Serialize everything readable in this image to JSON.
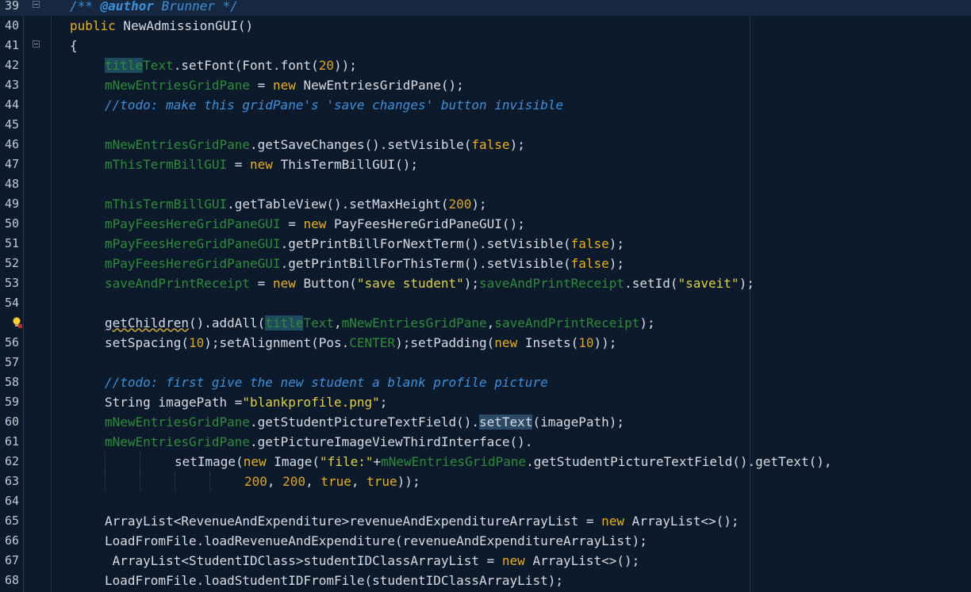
{
  "editor": {
    "theme_colors": {
      "background": "#0d1a2c",
      "keyword": "#e8b021",
      "field": "#2e8b39",
      "string": "#e0cf4a",
      "comment": "#3f8fd9",
      "text": "#d8dce2"
    },
    "lines": [
      {
        "num": "39",
        "current": true,
        "indent": 1,
        "fold": true,
        "tokens": [
          [
            "c",
            "/** "
          ],
          [
            "ca",
            "@author"
          ],
          [
            "c",
            " Brunner */"
          ]
        ]
      },
      {
        "num": "40",
        "indent": 1,
        "tokens": [
          [
            "k",
            "public"
          ],
          [
            "t",
            " NewAdmissionGUI()"
          ]
        ]
      },
      {
        "num": "41",
        "indent": 1,
        "fold": true,
        "tokens": [
          [
            "t",
            "{"
          ]
        ]
      },
      {
        "num": "42",
        "indent": 2,
        "tokens": [
          [
            "fh",
            "title"
          ],
          [
            "f",
            "Text"
          ],
          [
            "t",
            ".setFont(Font.font("
          ],
          [
            "n",
            "20"
          ],
          [
            "t",
            "));"
          ]
        ]
      },
      {
        "num": "43",
        "indent": 2,
        "tokens": [
          [
            "f",
            "mNewEntriesGridPane"
          ],
          [
            "t",
            " = "
          ],
          [
            "k",
            "new"
          ],
          [
            "t",
            " NewEntriesGridPane();"
          ]
        ]
      },
      {
        "num": "44",
        "indent": 2,
        "tokens": [
          [
            "c",
            "//todo: make this gridPane's 'save changes' button invisible"
          ]
        ]
      },
      {
        "num": "45",
        "indent": 2,
        "tokens": []
      },
      {
        "num": "46",
        "indent": 2,
        "tokens": [
          [
            "f",
            "mNewEntriesGridPane"
          ],
          [
            "t",
            ".getSaveChanges().setVisible("
          ],
          [
            "k",
            "false"
          ],
          [
            "t",
            ");"
          ]
        ]
      },
      {
        "num": "47",
        "indent": 2,
        "tokens": [
          [
            "f",
            "mThisTermBillGUI"
          ],
          [
            "t",
            " = "
          ],
          [
            "k",
            "new"
          ],
          [
            "t",
            " ThisTermBillGUI();"
          ]
        ]
      },
      {
        "num": "48",
        "indent": 2,
        "tokens": []
      },
      {
        "num": "49",
        "indent": 2,
        "tokens": [
          [
            "f",
            "mThisTermBillGUI"
          ],
          [
            "t",
            ".getTableView().setMaxHeight("
          ],
          [
            "n",
            "200"
          ],
          [
            "t",
            ");"
          ]
        ]
      },
      {
        "num": "50",
        "indent": 2,
        "tokens": [
          [
            "f",
            "mPayFeesHereGridPaneGUI"
          ],
          [
            "t",
            " = "
          ],
          [
            "k",
            "new"
          ],
          [
            "t",
            " PayFeesHereGridPaneGUI();"
          ]
        ]
      },
      {
        "num": "51",
        "indent": 2,
        "tokens": [
          [
            "f",
            "mPayFeesHereGridPaneGUI"
          ],
          [
            "t",
            ".getPrintBillForNextTerm().setVisible("
          ],
          [
            "k",
            "false"
          ],
          [
            "t",
            ");"
          ]
        ]
      },
      {
        "num": "52",
        "indent": 2,
        "tokens": [
          [
            "f",
            "mPayFeesHereGridPaneGUI"
          ],
          [
            "t",
            ".getPrintBillForThisTerm().setVisible("
          ],
          [
            "k",
            "false"
          ],
          [
            "t",
            ");"
          ]
        ]
      },
      {
        "num": "53",
        "indent": 2,
        "tokens": [
          [
            "f",
            "saveAndPrintReceipt"
          ],
          [
            "t",
            " = "
          ],
          [
            "k",
            "new"
          ],
          [
            "t",
            " Button("
          ],
          [
            "s",
            "\"save student\""
          ],
          [
            "t",
            ");"
          ],
          [
            "f",
            "saveAndPrintReceipt"
          ],
          [
            "t",
            ".setId("
          ],
          [
            "s",
            "\"saveit\""
          ],
          [
            "t",
            ");"
          ]
        ]
      },
      {
        "num": "54",
        "indent": 2,
        "tokens": []
      },
      {
        "num": "",
        "bulb": true,
        "indent": 2,
        "tokens": [
          [
            "w",
            "getChildren"
          ],
          [
            "t",
            "().addAll("
          ],
          [
            "fh",
            "title"
          ],
          [
            "f",
            "Text"
          ],
          [
            "t",
            ","
          ],
          [
            "f",
            "mNewEntriesGridPane"
          ],
          [
            "t",
            ","
          ],
          [
            "f",
            "saveAndPrintReceipt"
          ],
          [
            "t",
            ");"
          ]
        ]
      },
      {
        "num": "56",
        "indent": 2,
        "tokens": [
          [
            "t",
            "setSpacing("
          ],
          [
            "n",
            "10"
          ],
          [
            "t",
            ");setAlignment(Pos."
          ],
          [
            "f",
            "CENTER"
          ],
          [
            "t",
            ");setPadding("
          ],
          [
            "k",
            "new"
          ],
          [
            "t",
            " Insets("
          ],
          [
            "n",
            "10"
          ],
          [
            "t",
            "));"
          ]
        ]
      },
      {
        "num": "57",
        "indent": 2,
        "tokens": []
      },
      {
        "num": "58",
        "indent": 2,
        "tokens": [
          [
            "c",
            "//todo: first give the new student a blank profile picture"
          ]
        ]
      },
      {
        "num": "59",
        "indent": 2,
        "tokens": [
          [
            "t",
            "String imagePath ="
          ],
          [
            "s",
            "\"blankprofile.png\""
          ],
          [
            "t",
            ";"
          ]
        ]
      },
      {
        "num": "60",
        "indent": 2,
        "tokens": [
          [
            "f",
            "mNewEntriesGridPane"
          ],
          [
            "t",
            ".getStudentPictureTextField()."
          ],
          [
            "th",
            "setText"
          ],
          [
            "t",
            "(imagePath);"
          ]
        ]
      },
      {
        "num": "61",
        "indent": 2,
        "tokens": [
          [
            "f",
            "mNewEntriesGridPane"
          ],
          [
            "t",
            ".getPictureImageViewThirdInterface()."
          ]
        ]
      },
      {
        "num": "62",
        "indent": 4,
        "guides": [
          2,
          3
        ],
        "tokens": [
          [
            "t",
            "setImage("
          ],
          [
            "k",
            "new"
          ],
          [
            "t",
            " Image("
          ],
          [
            "s",
            "\"file:\""
          ],
          [
            "t",
            "+"
          ],
          [
            "f",
            "mNewEntriesGridPane"
          ],
          [
            "t",
            ".getStudentPictureTextField().getText(),"
          ]
        ]
      },
      {
        "num": "63",
        "indent": 6,
        "guides": [
          2,
          3,
          4,
          5
        ],
        "tokens": [
          [
            "n",
            "200"
          ],
          [
            "t",
            ", "
          ],
          [
            "n",
            "200"
          ],
          [
            "t",
            ", "
          ],
          [
            "k",
            "true"
          ],
          [
            "t",
            ", "
          ],
          [
            "k",
            "true"
          ],
          [
            "t",
            "));"
          ]
        ]
      },
      {
        "num": "64",
        "indent": 2,
        "tokens": []
      },
      {
        "num": "65",
        "indent": 2,
        "tokens": [
          [
            "t",
            "ArrayList<RevenueAndExpenditure>revenueAndExpenditureArrayList = "
          ],
          [
            "k",
            "new"
          ],
          [
            "t",
            " ArrayList<>();"
          ]
        ]
      },
      {
        "num": "66",
        "indent": 2,
        "tokens": [
          [
            "t",
            "LoadFromFile.loadRevenueAndExpenditure(revenueAndExpenditureArrayList);"
          ]
        ]
      },
      {
        "num": "67",
        "indent": 2,
        "tokens": [
          [
            "t",
            " ArrayList<StudentIDClass>studentIDClassArrayList = "
          ],
          [
            "k",
            "new"
          ],
          [
            "t",
            " ArrayList<>();"
          ]
        ]
      },
      {
        "num": "68",
        "indent": 2,
        "tokens": [
          [
            "t",
            "LoadFromFile.loadStudentIDFromFile(studentIDClassArrayList);"
          ]
        ]
      }
    ]
  }
}
